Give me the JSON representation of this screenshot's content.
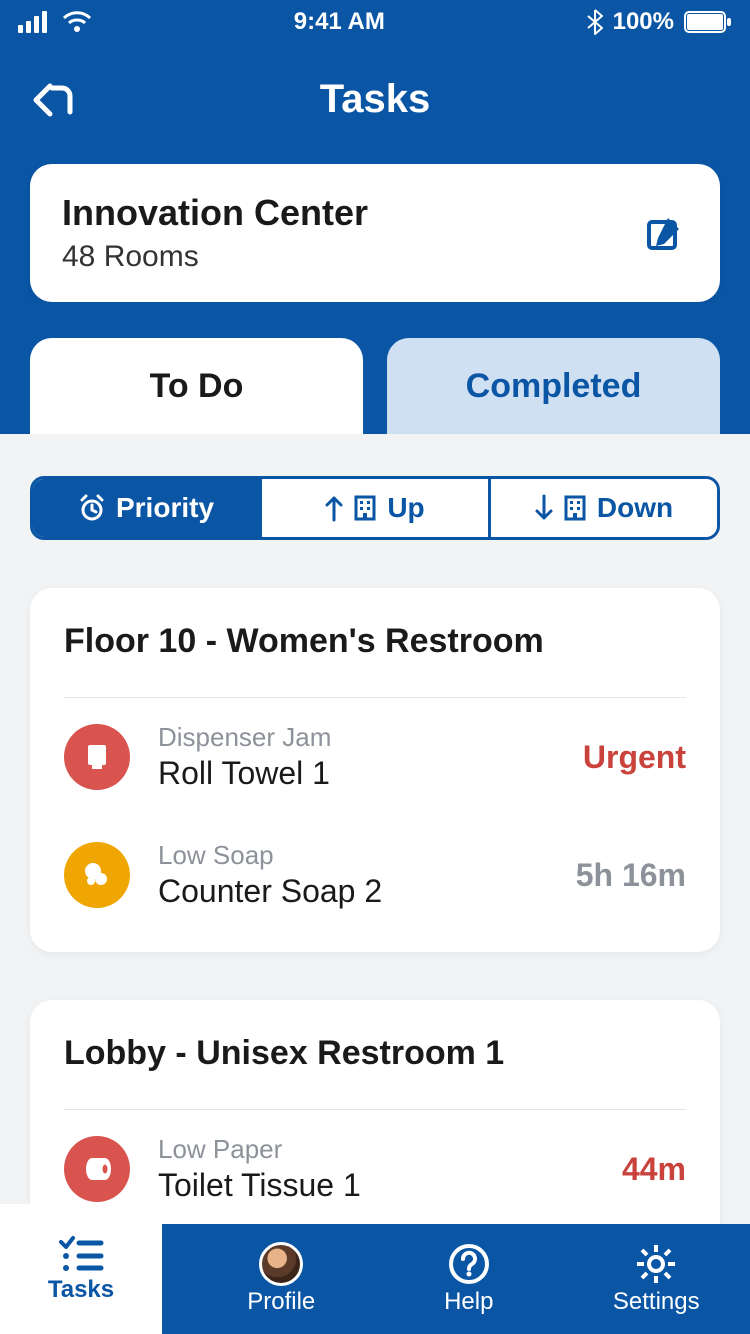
{
  "status_bar": {
    "time": "9:41 AM",
    "battery": "100%"
  },
  "header": {
    "title": "Tasks"
  },
  "location": {
    "name": "Innovation Center",
    "sub": "48 Rooms"
  },
  "tabs": {
    "todo": "To Do",
    "completed": "Completed"
  },
  "sort": {
    "priority": "Priority",
    "up": "Up",
    "down": "Down"
  },
  "groups": [
    {
      "title": "Floor 10 - Women's Restroom",
      "tasks": [
        {
          "kind": "Dispenser Jam",
          "name": "Roll Towel 1",
          "status": "Urgent",
          "status_class": "status-urgent",
          "icon_color": "icon-red",
          "icon": "towel"
        },
        {
          "kind": "Low Soap",
          "name": "Counter Soap 2",
          "status": "5h 16m",
          "status_class": "status-gray",
          "icon_color": "icon-amber",
          "icon": "soap"
        }
      ]
    },
    {
      "title": "Lobby - Unisex Restroom 1",
      "tasks": [
        {
          "kind": "Low Paper",
          "name": "Toilet Tissue 1",
          "status": "44m",
          "status_class": "status-red",
          "icon_color": "icon-red",
          "icon": "tissue"
        }
      ]
    }
  ],
  "bottom_nav": {
    "tasks": "Tasks",
    "profile": "Profile",
    "help": "Help",
    "settings": "Settings"
  }
}
